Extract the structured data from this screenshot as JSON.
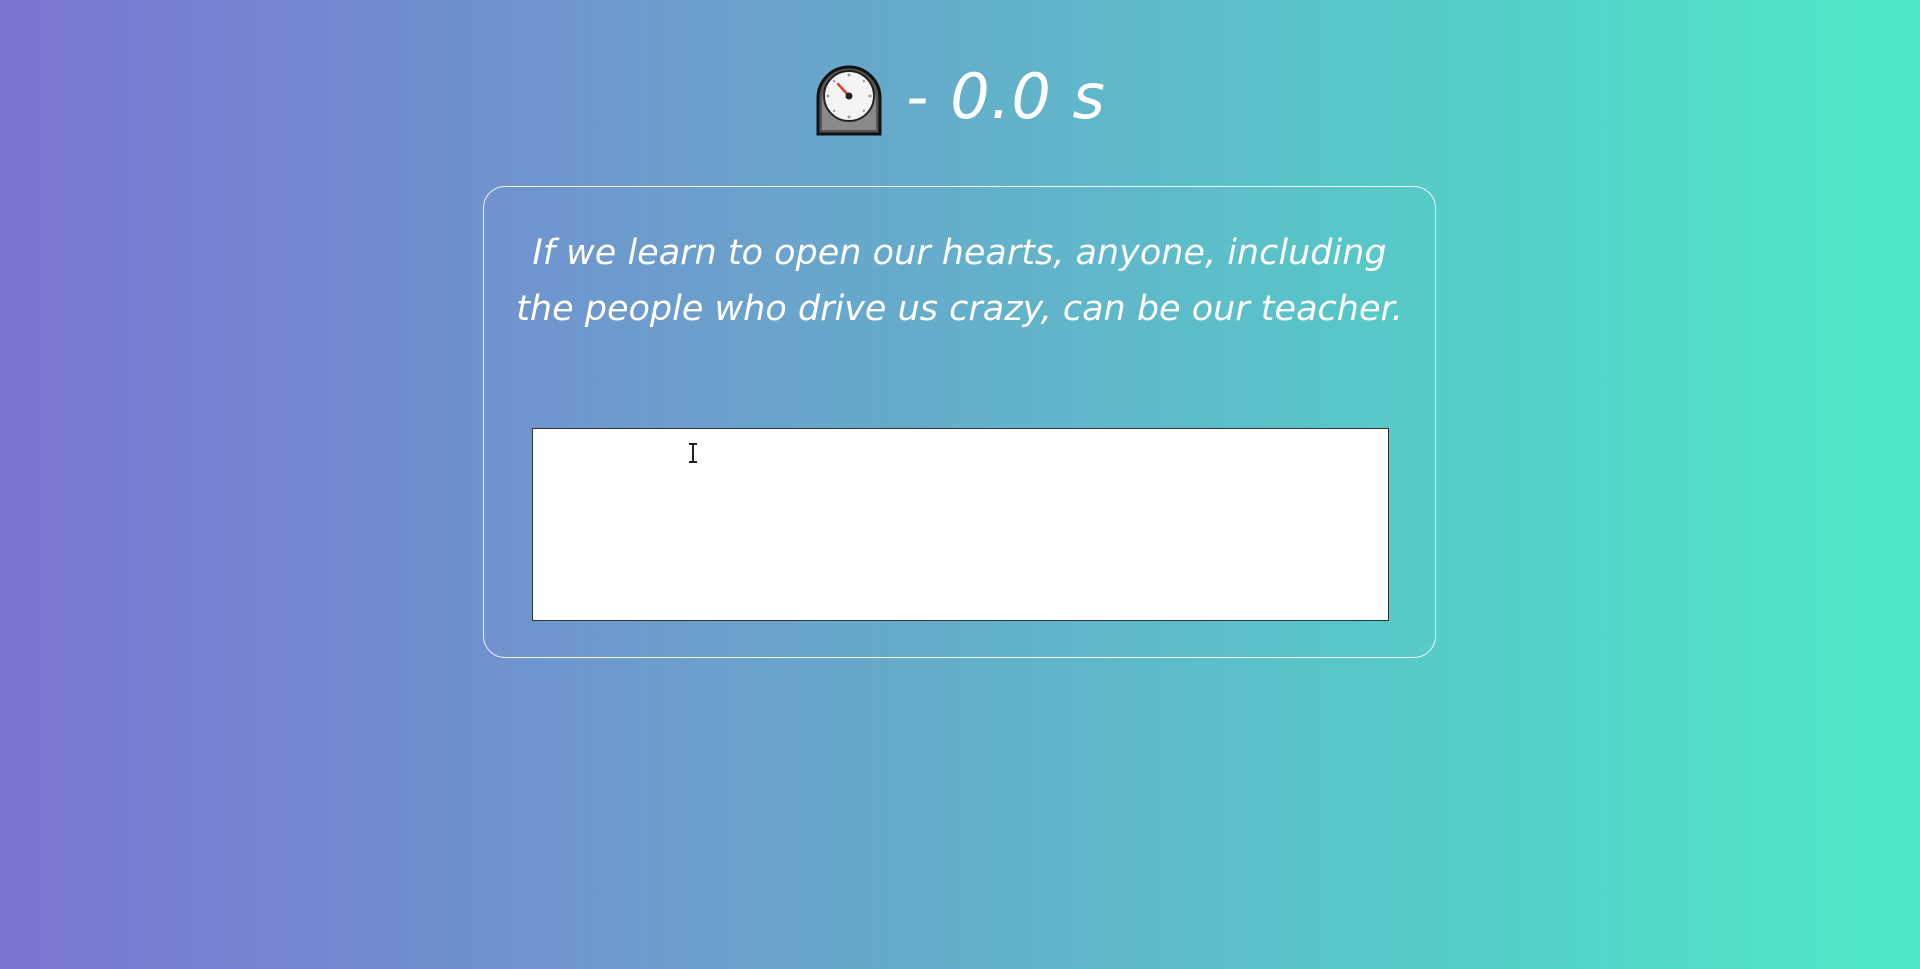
{
  "timer": {
    "icon": "stopwatch-icon",
    "text": "- 0.0 s"
  },
  "quote": {
    "text": "If we learn to open our hearts, anyone, including the people who drive us crazy, can be our teacher."
  },
  "input": {
    "value": "",
    "placeholder": ""
  },
  "colors": {
    "gradient_start": "#7b75d2",
    "gradient_end": "#4ee9c7",
    "text": "#ffffff"
  }
}
